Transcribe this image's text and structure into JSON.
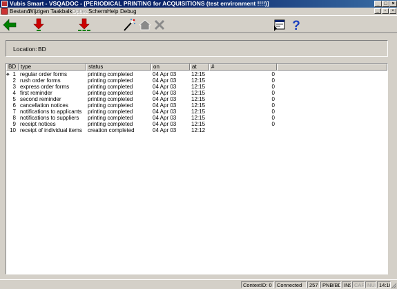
{
  "window": {
    "title": "Vubis Smart - VSQADOC - [PERIODICAL PRINTING for ACQUISITIONS (test environment !!!!)]",
    "minimize": "_",
    "maximize": "□",
    "close": "×"
  },
  "menu": {
    "items": [
      {
        "label": "Bestand",
        "enabled": true
      },
      {
        "label": "Wijzigen",
        "enabled": true
      },
      {
        "label": "Taakbalk",
        "enabled": true
      },
      {
        "label": "Opties",
        "enabled": false
      },
      {
        "label": "Scherm",
        "enabled": true
      },
      {
        "label": "Help",
        "enabled": true
      },
      {
        "label": "Debug",
        "enabled": true
      }
    ]
  },
  "toolbar": {
    "icons": [
      "back-arrow-icon",
      "print-single-icon",
      "print-all-icon",
      "wizard-wand-icon",
      "home-icon",
      "delete-icon",
      "screen-icon",
      "help-icon"
    ]
  },
  "location": {
    "label": "Location:",
    "value": "BD"
  },
  "table": {
    "headers": {
      "bd": "BD",
      "type": "type",
      "status": "status",
      "on": "on",
      "at": "at",
      "num": "#"
    },
    "rows": [
      {
        "n": "1",
        "type": "regular order forms",
        "status": "printing completed",
        "on": "04 Apr 03",
        "at": "12:15",
        "num": "0"
      },
      {
        "n": "2",
        "type": "rush order forms",
        "status": "printing completed",
        "on": "04 Apr 03",
        "at": "12:15",
        "num": "0"
      },
      {
        "n": "3",
        "type": "express order forms",
        "status": "printing completed",
        "on": "04 Apr 03",
        "at": "12:15",
        "num": "0"
      },
      {
        "n": "4",
        "type": "first reminder",
        "status": "printing completed",
        "on": "04 Apr 03",
        "at": "12:15",
        "num": "0"
      },
      {
        "n": "5",
        "type": "second reminder",
        "status": "printing completed",
        "on": "04 Apr 03",
        "at": "12:15",
        "num": "0"
      },
      {
        "n": "6",
        "type": "cancellation notices",
        "status": "printing completed",
        "on": "04 Apr 03",
        "at": "12:15",
        "num": "0"
      },
      {
        "n": "7",
        "type": "notifications to applicants",
        "status": "printing completed",
        "on": "04 Apr 03",
        "at": "12:15",
        "num": "0"
      },
      {
        "n": "8",
        "type": "notifications to suppliers",
        "status": "printing completed",
        "on": "04 Apr 03",
        "at": "12:15",
        "num": "0"
      },
      {
        "n": "9",
        "type": "receipt notices",
        "status": "printing completed",
        "on": "04 Apr 03",
        "at": "12:15",
        "num": "0"
      },
      {
        "n": "10",
        "type": "receipt of individual items",
        "status": "creation completed",
        "on": "04 Apr 03",
        "at": "12:12",
        "num": ""
      }
    ]
  },
  "statusbar": {
    "context": "ContextID: 0",
    "connection": "Connected",
    "count": "257",
    "location": "PNB/BD",
    "ins": "INS",
    "caps": "CAPS",
    "num": "NUM",
    "time": "14:10"
  },
  "colors": {
    "titlebar": "#0a246a",
    "face": "#d4d0c8",
    "arrow_red": "#cc0000",
    "arrow_green": "#008000",
    "help_blue": "#1a3fbf"
  }
}
